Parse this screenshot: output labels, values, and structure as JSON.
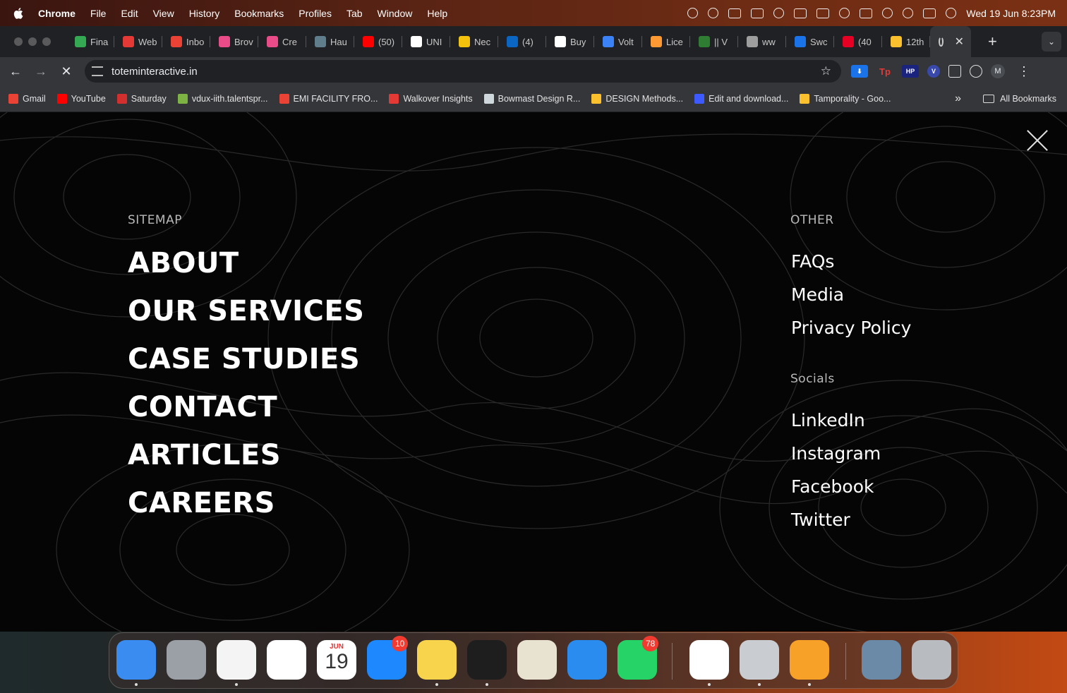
{
  "menubar": {
    "app": "Chrome",
    "items": [
      "File",
      "Edit",
      "View",
      "History",
      "Bookmarks",
      "Profiles",
      "Tab",
      "Window",
      "Help"
    ],
    "clock": "Wed 19 Jun  8:23PM"
  },
  "tabs": [
    {
      "label": "Fina",
      "color": "#34a853"
    },
    {
      "label": "Web",
      "color": "#e53935"
    },
    {
      "label": "Inbo",
      "color": "#ea4335"
    },
    {
      "label": "Brov",
      "color": "#ea4c89"
    },
    {
      "label": "Cre",
      "color": "#ea4c89"
    },
    {
      "label": "Hau",
      "color": "#607d8b"
    },
    {
      "label": "(50)",
      "color": "#ff0000"
    },
    {
      "label": "UNI",
      "color": "#ffffff"
    },
    {
      "label": "Nec",
      "color": "#f4c20d"
    },
    {
      "label": "(4)",
      "color": "#0a66c2"
    },
    {
      "label": "Buy",
      "color": "#ffffff"
    },
    {
      "label": "Volt",
      "color": "#3b82f6"
    },
    {
      "label": "Lice",
      "color": "#ff9933"
    },
    {
      "label": "|| V",
      "color": "#2e7d32"
    },
    {
      "label": "ww",
      "color": "#9e9e9e"
    },
    {
      "label": "Swc",
      "color": "#1a73e8"
    },
    {
      "label": "(40",
      "color": "#e60023"
    },
    {
      "label": "12th",
      "color": "#fbc02d"
    }
  ],
  "address": {
    "url": "toteminteractive.in"
  },
  "bookmarks": [
    {
      "label": "Gmail",
      "color": "#ea4335"
    },
    {
      "label": "YouTube",
      "color": "#ff0000"
    },
    {
      "label": "Saturday",
      "color": "#d32f2f"
    },
    {
      "label": "vdux-iith.talentspr...",
      "color": "#7cb342"
    },
    {
      "label": "EMI FACILITY FRO...",
      "color": "#ea4335"
    },
    {
      "label": "Walkover Insights",
      "color": "#e53935"
    },
    {
      "label": "Bowmast Design R...",
      "color": "#cfd8dc"
    },
    {
      "label": "DESIGN Methods...",
      "color": "#fbc02d"
    },
    {
      "label": "Edit and download...",
      "color": "#3d5afe"
    },
    {
      "label": "Tamporality - Goo...",
      "color": "#fbc02d"
    }
  ],
  "bookmarks_all": "All Bookmarks",
  "menu": {
    "sitemap_label": "SITEMAP",
    "sitemap": [
      "ABOUT",
      "OUR SERVICES",
      "CASE STUDIES",
      "CONTACT",
      "ARTICLES",
      "CAREERS"
    ],
    "other_label": "OTHER",
    "other": [
      "FAQs",
      "Media",
      "Privacy Policy"
    ],
    "socials_label": "Socials",
    "socials": [
      "LinkedIn",
      "Instagram",
      "Facebook",
      "Twitter"
    ]
  },
  "dock": {
    "calendar_month": "JUN",
    "calendar_day": "19",
    "appstore_badge": "10",
    "whatsapp_badge": "78",
    "apps": [
      {
        "name": "finder-icon",
        "color": "#3b8cf0"
      },
      {
        "name": "launchpad-icon",
        "color": "#9aa0a6"
      },
      {
        "name": "chrome-icon",
        "color": "#f4f4f4"
      },
      {
        "name": "photos-icon",
        "color": "#ffffff"
      },
      {
        "name": "calendar-icon",
        "color": "#ffffff"
      },
      {
        "name": "app-store-icon",
        "color": "#1e88ff"
      },
      {
        "name": "notes-icon",
        "color": "#f8d44c"
      },
      {
        "name": "figma-icon",
        "color": "#1e1e1e"
      },
      {
        "name": "preview-icon",
        "color": "#e8e2d0"
      },
      {
        "name": "safari-icon",
        "color": "#2b8cf0"
      },
      {
        "name": "whatsapp-icon",
        "color": "#25d366"
      },
      {
        "name": "slack-icon",
        "color": "#ffffff"
      },
      {
        "name": "font-book-icon",
        "color": "#c9ccd1"
      },
      {
        "name": "pages-icon",
        "color": "#f7a128"
      },
      {
        "name": "screenshot-icon",
        "color": "#6b8aa8"
      },
      {
        "name": "trash-icon",
        "color": "#b8bcc0"
      }
    ]
  }
}
